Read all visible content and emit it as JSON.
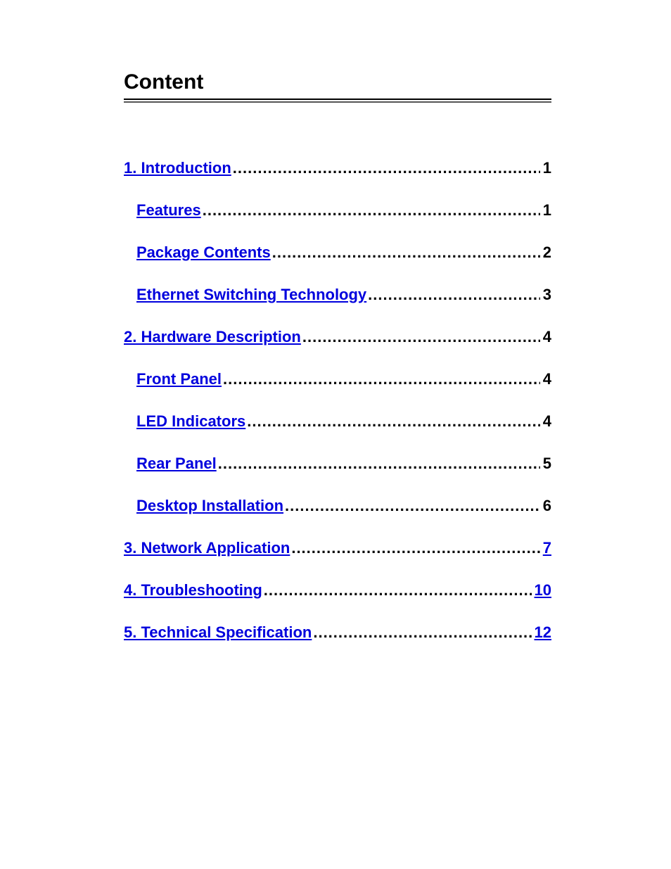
{
  "title": "Content",
  "entries": [
    {
      "label": "1. Introduction",
      "page": "1",
      "level": 1,
      "pageLinked": false
    },
    {
      "label": "Features",
      "page": "1",
      "level": 2,
      "pageLinked": false
    },
    {
      "label": "Package Contents",
      "page": "2",
      "level": 2,
      "pageLinked": false
    },
    {
      "label": "Ethernet Switching Technology",
      "page": "3",
      "level": 2,
      "pageLinked": false
    },
    {
      "label": "2. Hardware Description",
      "page": "4",
      "level": 1,
      "pageLinked": false
    },
    {
      "label": "Front Panel",
      "page": "4",
      "level": 2,
      "pageLinked": false
    },
    {
      "label": "LED Indicators",
      "page": "4",
      "level": 2,
      "pageLinked": false
    },
    {
      "label": "Rear Panel",
      "page": "5",
      "level": 2,
      "pageLinked": false
    },
    {
      "label": "Desktop Installation",
      "page": "6",
      "level": 2,
      "pageLinked": false
    },
    {
      "label": "3. Network Application",
      "page": "7",
      "level": 1,
      "pageLinked": true
    },
    {
      "label": "4. Troubleshooting",
      "page": "10",
      "level": 1,
      "pageLinked": true
    },
    {
      "label": "5. Technical Specification",
      "page": "12",
      "level": 1,
      "pageLinked": true
    }
  ],
  "dots": "................................................................................................................"
}
